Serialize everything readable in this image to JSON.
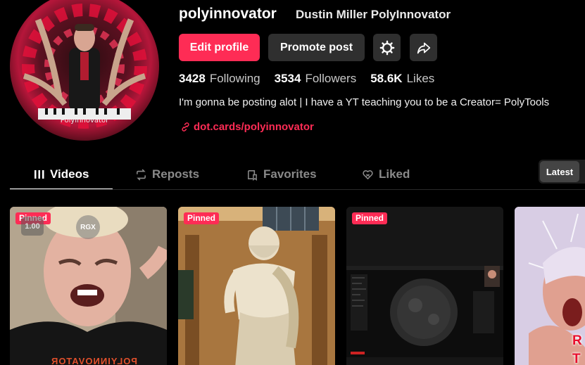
{
  "profile": {
    "username": "polyinnovator",
    "display_name": "Dustin Miller PolyInnovator",
    "avatar_caption": "PolyInnovator",
    "bio": "I'm gonna be posting alot | I have a YT teaching you to be a Creator= PolyTools",
    "link": "dot.cards/polyinnovator"
  },
  "actions": {
    "edit_profile": "Edit profile",
    "promote_post": "Promote post",
    "settings_icon": "gear-icon",
    "share_icon": "share-arrow-icon"
  },
  "stats": [
    {
      "value": "3428",
      "label": "Following"
    },
    {
      "value": "3534",
      "label": "Followers"
    },
    {
      "value": "58.6K",
      "label": "Likes"
    }
  ],
  "tabs": [
    {
      "label": "Videos",
      "icon": "grid-icon",
      "active": true
    },
    {
      "label": "Reposts",
      "icon": "repost-icon",
      "active": false
    },
    {
      "label": "Favorites",
      "icon": "bookmark-icon",
      "active": false
    },
    {
      "label": "Liked",
      "icon": "heart-icon",
      "active": false
    }
  ],
  "sort": {
    "selected": "Latest"
  },
  "videos": [
    {
      "pinned": "Pinned",
      "speed": "1.00",
      "badge": "RGX",
      "shirt": "POLYINNOVATOR"
    },
    {
      "pinned": "Pinned"
    },
    {
      "pinned": "Pinned"
    },
    {
      "overlay_text": "R\nT"
    }
  ],
  "colors": {
    "accent": "#fe2c55",
    "background": "#000000",
    "button_dark": "#2f2f2f"
  }
}
